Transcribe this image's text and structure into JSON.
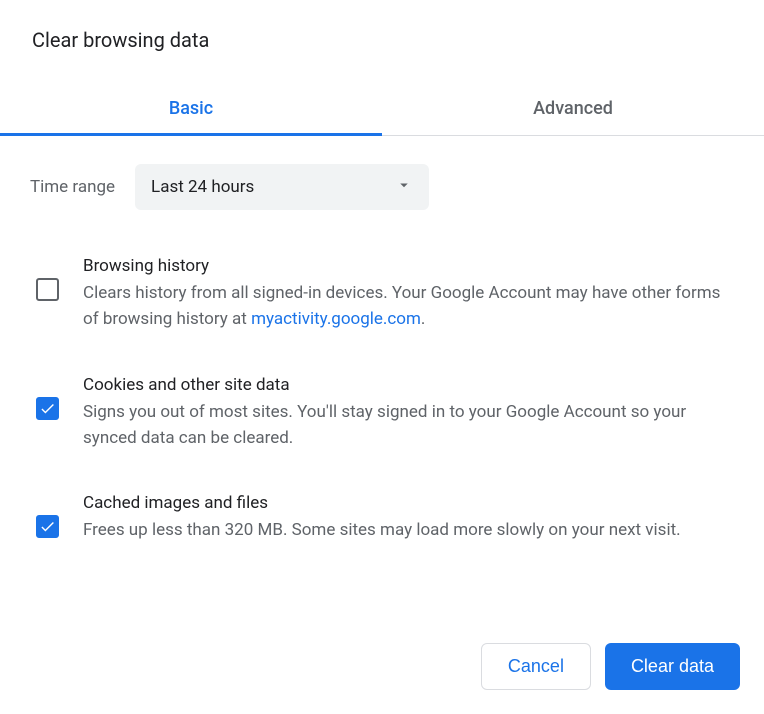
{
  "dialog": {
    "title": "Clear browsing data"
  },
  "tabs": {
    "basic": "Basic",
    "advanced": "Advanced",
    "active": "basic"
  },
  "timeRange": {
    "label": "Time range",
    "value": "Last 24 hours"
  },
  "options": [
    {
      "checked": false,
      "title": "Browsing history",
      "descPre": "Clears history from all signed-in devices. Your Google Account may have other forms of browsing history at ",
      "link": "myactivity.google.com",
      "descPost": "."
    },
    {
      "checked": true,
      "title": "Cookies and other site data",
      "desc": "Signs you out of most sites. You'll stay signed in to your Google Account so your synced data can be cleared."
    },
    {
      "checked": true,
      "title": "Cached images and files",
      "desc": "Frees up less than 320 MB. Some sites may load more slowly on your next visit."
    }
  ],
  "buttons": {
    "cancel": "Cancel",
    "clear": "Clear data"
  },
  "colors": {
    "primary": "#1a73e8",
    "textPrimary": "#202124",
    "textSecondary": "#5f6368",
    "border": "#dadce0",
    "selectBg": "#f1f3f4"
  }
}
